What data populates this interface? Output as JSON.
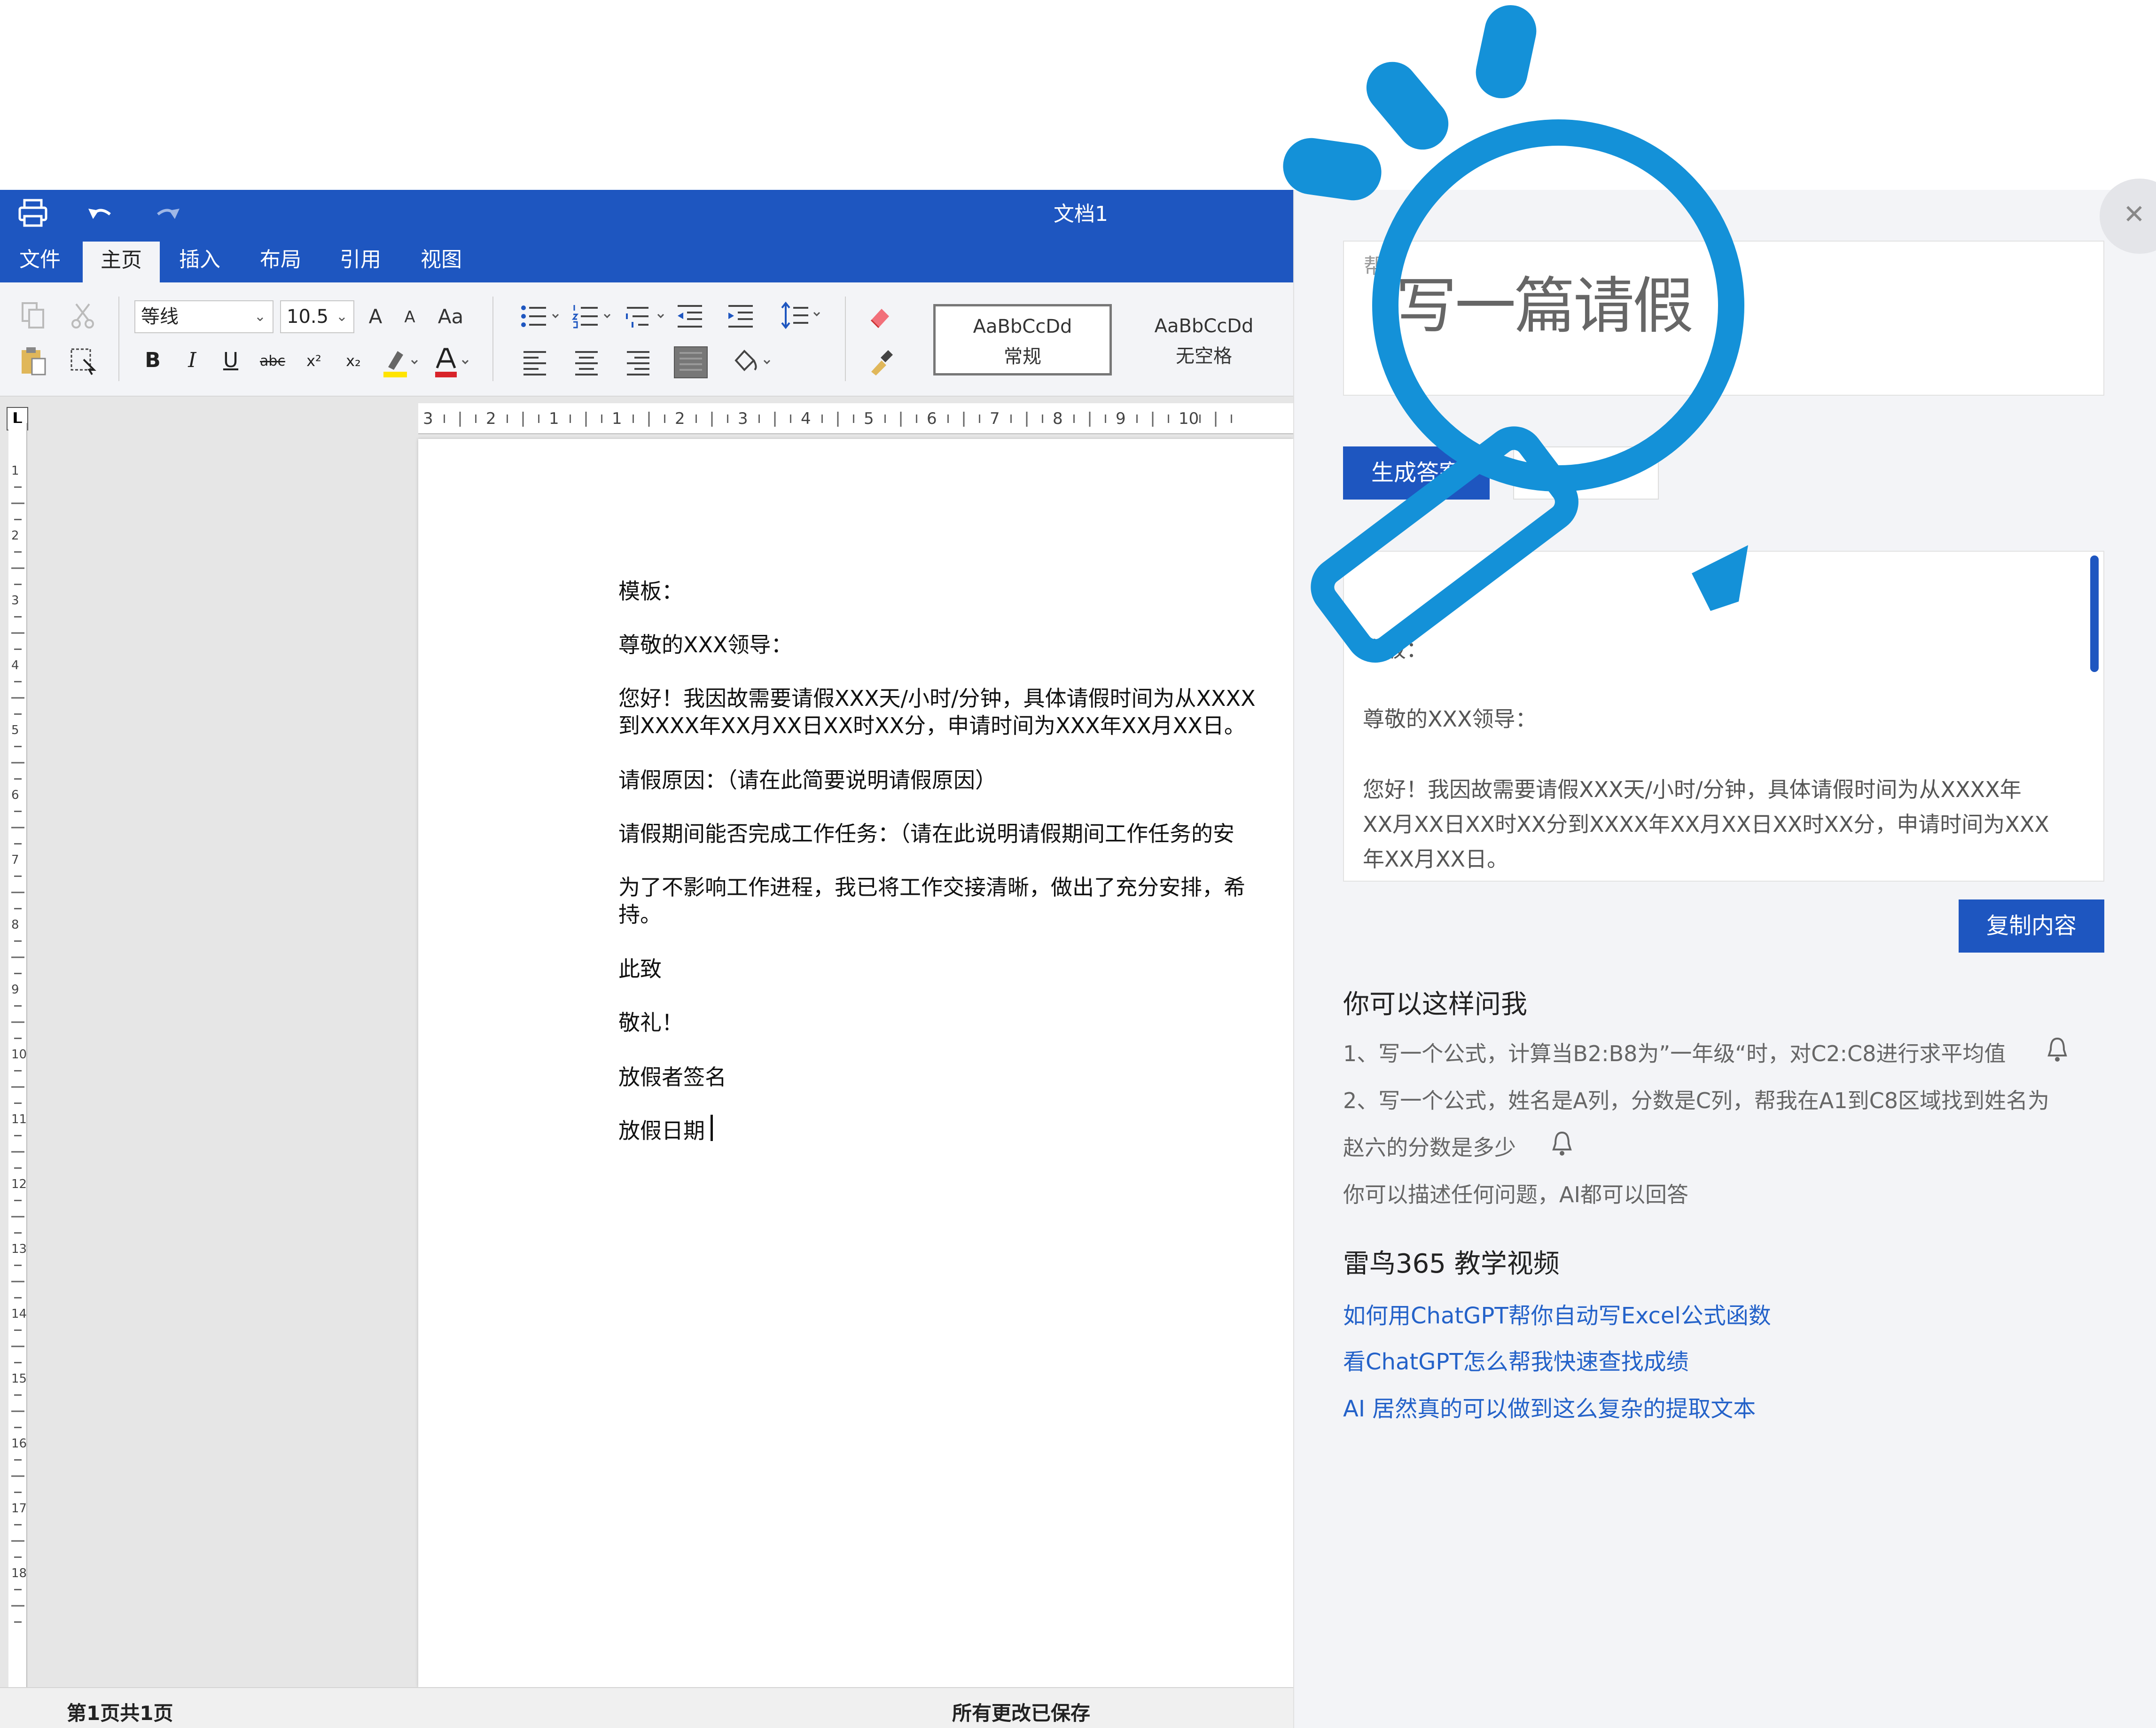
{
  "titlebar": {
    "doc_title": "文档1",
    "print_icon": "print-icon",
    "undo_icon": "undo-icon",
    "redo_icon": "redo-icon"
  },
  "tabs": [
    {
      "label": "文件"
    },
    {
      "label": "主页"
    },
    {
      "label": "插入"
    },
    {
      "label": "布局"
    },
    {
      "label": "引用"
    },
    {
      "label": "视图"
    }
  ],
  "active_tab": "主页",
  "ribbon": {
    "font_name": "等线",
    "font_size": "10.5",
    "bold": "B",
    "italic": "I",
    "underline": "U",
    "strike": "abc",
    "superscript": "x²",
    "subscript": "x₂",
    "grow": "A",
    "shrink": "A",
    "change_case": "Aa",
    "styles": [
      {
        "sample": "AaBbCcDd",
        "name": "常规"
      },
      {
        "sample": "AaBbCcDd",
        "name": "无空格"
      }
    ]
  },
  "ruler": {
    "corner": "L",
    "numbers": [
      "3",
      "2",
      "1",
      "1",
      "2",
      "3",
      "4",
      "5",
      "6",
      "7",
      "8",
      "9",
      "10"
    ],
    "vnumbers": [
      "1",
      "2",
      "3",
      "4",
      "5",
      "6",
      "7",
      "8",
      "9",
      "10",
      "11",
      "12",
      "13",
      "14",
      "15",
      "16",
      "17",
      "18"
    ]
  },
  "document": {
    "lines": [
      "模板：",
      "尊敬的XXX领导：",
      "您好！我因故需要请假XXX天/小时/分钟，具体请假时间为从XXXX",
      "到XXXX年XX月XX日XX时XX分，申请时间为XXX年XX月XX日。",
      "请假原因：（请在此简要说明请假原因）",
      "请假期间能否完成工作任务：（请在此说明请假期间工作任务的安",
      "为了不影响工作进程，我已将工作交接清晰，做出了充分安排，希",
      "持。",
      "此致",
      "敬礼！",
      "放假者签名",
      "放假日期"
    ]
  },
  "status": {
    "page_info": "第1页共1页",
    "save_status": "所有更改已保存"
  },
  "panel": {
    "close_icon": "close-icon",
    "prompt_label": "帮",
    "prompt_text": "写一篇请假",
    "generate_button": "生成答案",
    "answer_lines": [
      "模板：",
      "尊敬的XXX领导：",
      "您好！我因故需要请假XXX天/小时/分钟，具体请假时间为从XXXX年",
      "XX月XX日XX时XX分到XXXX年XX月XX日XX时XX分，申请时间为XXX",
      "年XX月XX日。"
    ],
    "copy_button": "复制内容",
    "ask_heading": "你可以这样问我",
    "hints": [
      "1、写一个公式，计算当B2:B8为”一年级“时，对C2:C8进行求平均值",
      "2、写一个公式，姓名是A列，分数是C列，帮我在A1到C8区域找到姓名为",
      "赵六的分数是多少",
      "你可以描述任何问题，AI都可以回答"
    ],
    "video_heading": "雷鸟365 教学视频",
    "links": [
      "如何用ChatGPT帮你自动写Excel公式函数",
      "看ChatGPT怎么帮我快速查找成绩",
      "AI 居然真的可以做到这么复杂的提取文本"
    ]
  },
  "colors": {
    "brand": "#1e56c0",
    "magnifier": "#1491d8",
    "link": "#2462c9"
  }
}
